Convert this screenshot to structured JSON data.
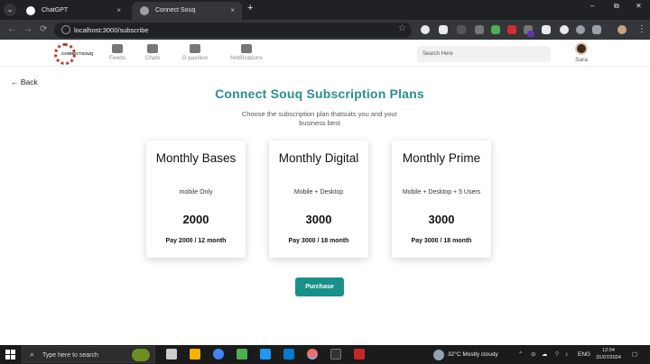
{
  "browser": {
    "tabs": [
      {
        "title": "ChatGPT",
        "close": "×"
      },
      {
        "title": "Connect Souq",
        "close": "×"
      }
    ],
    "new_tab": "+",
    "window_controls": [
      "⌄",
      "–",
      "⧉",
      "✕"
    ],
    "url": "localhost:3000/subscribe",
    "nav": [
      "←",
      "→",
      "⟳"
    ],
    "star": "☆",
    "menu": "⋮"
  },
  "app": {
    "logo_text": "CONNECTSOUQ",
    "nav": [
      {
        "label": "Feeds",
        "icon": "home-icon"
      },
      {
        "label": "Chats",
        "icon": "chat-icon"
      },
      {
        "label": "G pavilion",
        "icon": "pavilion-icon"
      },
      {
        "label": "Notifications",
        "icon": "notification-icon"
      }
    ],
    "search_placeholder": "Search Here",
    "user_name": "Sara"
  },
  "page": {
    "back_label": "← Back",
    "title": "Connect Souq Subscription Plans",
    "subtitle": "Choose the subscription plan thatsuits you and your business best",
    "purchase_label": "Purchase"
  },
  "plans": [
    {
      "name": "Monthly Bases",
      "description": "mobile Only",
      "price": "2000",
      "terms": "Pay 2000 / 12 month"
    },
    {
      "name": "Monthly Digital",
      "description": "Mobile + Desktop",
      "price": "3000",
      "terms": "Pay 3000 / 18 month"
    },
    {
      "name": "Monthly Prime",
      "description": "Mobile + Desktop + 5 Users",
      "price": "3000",
      "terms": "Pay 3000 / 18 month"
    }
  ],
  "taskbar": {
    "search_placeholder": "Type here to search",
    "weather": "32°C  Mostly cloudy",
    "language": "ENG",
    "time": "12:04",
    "date": "31/07/2024"
  },
  "colors": {
    "accent": "#19908a",
    "title": "#2a8f8a"
  }
}
